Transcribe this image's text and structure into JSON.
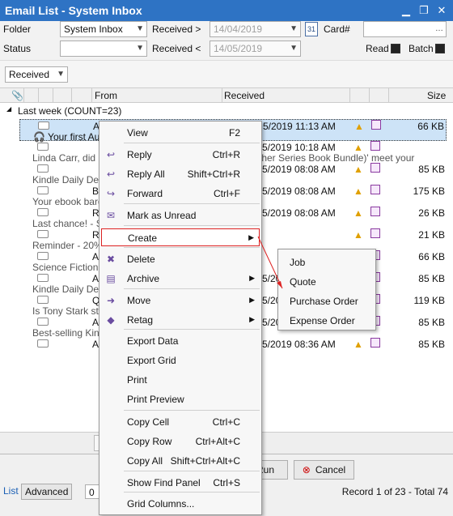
{
  "window": {
    "title": "Email List - System Inbox"
  },
  "filters": {
    "folder_label": "Folder",
    "folder_value": "System Inbox",
    "status_label": "Status",
    "status_value": "",
    "received_gt_label": "Received >",
    "received_gt_value": "14/04/2019",
    "received_lt_label": "Received <",
    "received_lt_value": "14/05/2019",
    "card_label": "Card#",
    "card_value": "",
    "read_label": "Read",
    "batch_label": "Batch"
  },
  "groupby": {
    "value": "Received"
  },
  "grid": {
    "columns": {
      "from": "From",
      "received": "Received",
      "size": "Size"
    },
    "group_label": "Last week (COUNT=23)",
    "rows": [
      {
        "from": "A",
        "received": "5/2019 11:13 AM",
        "size": "66 KB",
        "preview": "🎧 Your first Aud",
        "preview2": "",
        "selected": true
      },
      {
        "from": "",
        "received": "5/2019 10:18 AM",
        "size": "",
        "preview": "Linda Carr, did 'T",
        "preview2": "ther Series Book Bundle)' meet your",
        "selected": false
      },
      {
        "from": "",
        "received": "5/2019 08:08 AM",
        "size": "85 KB",
        "preview": "Kindle Daily Deal:",
        "preview2": "",
        "selected": false
      },
      {
        "from": "B",
        "received": "5/2019 08:08 AM",
        "size": "175 KB",
        "preview": "Your ebook barga",
        "preview2": "",
        "selected": false
      },
      {
        "from": "R",
        "received": "5/2019 08:08 AM",
        "size": "26 KB",
        "preview": "Last chance! - Sa",
        "preview2": "",
        "selected": false
      },
      {
        "from": "R",
        "received": "",
        "size": "21 KB",
        "preview": "Reminder - 20%",
        "preview2": "",
        "selected": false
      },
      {
        "from": "A",
        "received": "",
        "size": "66 KB",
        "preview": "Science Fiction Ki",
        "preview2": "",
        "selected": false
      },
      {
        "from": "A",
        "received": "5/2019 08:08 AM",
        "size": "85 KB",
        "preview": "Kindle Daily Deal:",
        "preview2": "",
        "selected": false
      },
      {
        "from": "Q",
        "received": "5/2019 08:30 AM",
        "size": "119 KB",
        "preview": "Is Tony Stark stil",
        "preview2": "",
        "selected": false
      },
      {
        "from": "A",
        "received": "5/2019 08:36 AM",
        "size": "85 KB",
        "preview": "Best-selling Kindle",
        "preview2": "",
        "selected": false
      },
      {
        "from": "A",
        "received": "5/2019 08:36 AM",
        "size": "85 KB",
        "preview": "",
        "preview2": "",
        "selected": false
      }
    ]
  },
  "bottom": {
    "run_label": "Run",
    "cancel_label": "Cancel",
    "tab_list": "List",
    "tab_advanced": "Advanced",
    "record_field": "0",
    "status": "Record 1 of 23 - Total 74"
  },
  "context_menu": {
    "items": [
      {
        "label": "View",
        "shortcut": "F2"
      },
      {
        "label": "Reply",
        "shortcut": "Ctrl+R"
      },
      {
        "label": "Reply All",
        "shortcut": "Shift+Ctrl+R"
      },
      {
        "label": "Forward",
        "shortcut": "Ctrl+F"
      },
      {
        "label": "Mark as Unread",
        "shortcut": ""
      },
      {
        "label": "Create",
        "shortcut": ""
      },
      {
        "label": "Delete",
        "shortcut": ""
      },
      {
        "label": "Archive",
        "shortcut": ""
      },
      {
        "label": "Move",
        "shortcut": ""
      },
      {
        "label": "Retag",
        "shortcut": ""
      },
      {
        "label": "Export Data",
        "shortcut": ""
      },
      {
        "label": "Export Grid",
        "shortcut": ""
      },
      {
        "label": "Print",
        "shortcut": ""
      },
      {
        "label": "Print Preview",
        "shortcut": ""
      },
      {
        "label": "Copy Cell",
        "shortcut": "Ctrl+C"
      },
      {
        "label": "Copy Row",
        "shortcut": "Ctrl+Alt+C"
      },
      {
        "label": "Copy All",
        "shortcut": "Shift+Ctrl+Alt+C"
      },
      {
        "label": "Show Find Panel",
        "shortcut": "Ctrl+S"
      },
      {
        "label": "Grid Columns...",
        "shortcut": ""
      }
    ]
  },
  "submenu": {
    "items": [
      "Job",
      "Quote",
      "Purchase Order",
      "Expense Order"
    ]
  },
  "colors": {
    "title_bar": "#2e73c4",
    "selection": "#cde3f7",
    "highlight_border": "#dd2222"
  }
}
